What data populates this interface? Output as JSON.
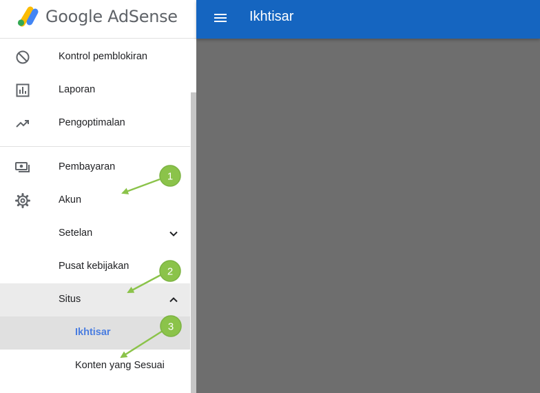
{
  "brand": {
    "logo_text": "Google AdSense"
  },
  "topbar": {
    "title": "Ikhtisar",
    "menu_icon": "menu-icon"
  },
  "sidebar": {
    "items": [
      {
        "label": "Kontrol pemblokiran",
        "icon": "block-icon"
      },
      {
        "label": "Laporan",
        "icon": "bar-chart-icon"
      },
      {
        "label": "Pengoptimalan",
        "icon": "trending-up-icon"
      },
      {
        "label": "Pembayaran",
        "icon": "payments-icon"
      },
      {
        "label": "Akun",
        "icon": "gear-icon"
      },
      {
        "label": "Setelan",
        "icon": "chevron-down-icon"
      },
      {
        "label": "Pusat kebijakan"
      },
      {
        "label": "Situs",
        "icon": "chevron-up-icon"
      },
      {
        "label": "Ikhtisar"
      },
      {
        "label": "Konten yang Sesuai"
      }
    ]
  },
  "annotations": [
    {
      "number": "1"
    },
    {
      "number": "2"
    },
    {
      "number": "3"
    }
  ],
  "colors": {
    "topbar": "#1565c0",
    "content_overlay": "#6e6e6e",
    "active_text": "#4a7de0",
    "annotation_marker": "#8bc34a"
  }
}
